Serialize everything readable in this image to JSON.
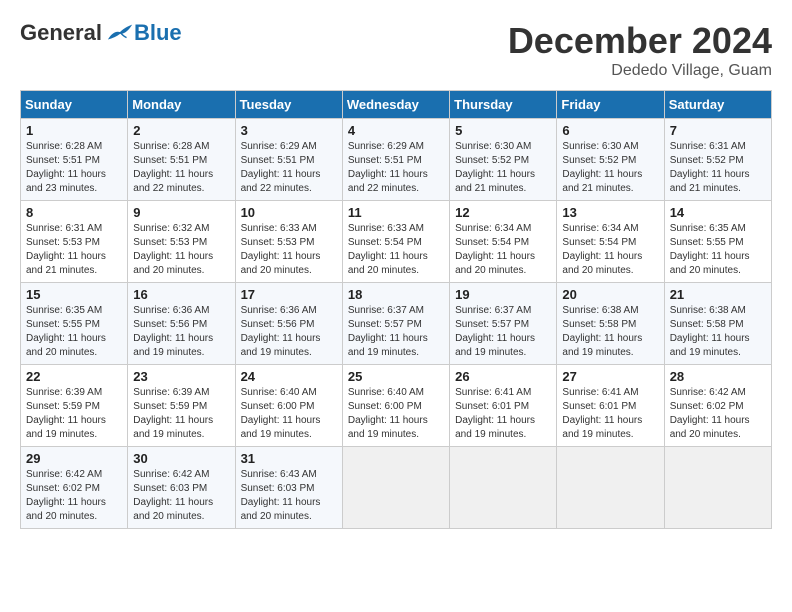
{
  "logo": {
    "general": "General",
    "blue": "Blue"
  },
  "title": "December 2024",
  "subtitle": "Dededo Village, Guam",
  "days_of_week": [
    "Sunday",
    "Monday",
    "Tuesday",
    "Wednesday",
    "Thursday",
    "Friday",
    "Saturday"
  ],
  "weeks": [
    [
      {
        "day": "1",
        "sunrise": "6:28 AM",
        "sunset": "5:51 PM",
        "daylight": "11 hours and 23 minutes."
      },
      {
        "day": "2",
        "sunrise": "6:28 AM",
        "sunset": "5:51 PM",
        "daylight": "11 hours and 22 minutes."
      },
      {
        "day": "3",
        "sunrise": "6:29 AM",
        "sunset": "5:51 PM",
        "daylight": "11 hours and 22 minutes."
      },
      {
        "day": "4",
        "sunrise": "6:29 AM",
        "sunset": "5:51 PM",
        "daylight": "11 hours and 22 minutes."
      },
      {
        "day": "5",
        "sunrise": "6:30 AM",
        "sunset": "5:52 PM",
        "daylight": "11 hours and 21 minutes."
      },
      {
        "day": "6",
        "sunrise": "6:30 AM",
        "sunset": "5:52 PM",
        "daylight": "11 hours and 21 minutes."
      },
      {
        "day": "7",
        "sunrise": "6:31 AM",
        "sunset": "5:52 PM",
        "daylight": "11 hours and 21 minutes."
      }
    ],
    [
      {
        "day": "8",
        "sunrise": "6:31 AM",
        "sunset": "5:53 PM",
        "daylight": "11 hours and 21 minutes."
      },
      {
        "day": "9",
        "sunrise": "6:32 AM",
        "sunset": "5:53 PM",
        "daylight": "11 hours and 20 minutes."
      },
      {
        "day": "10",
        "sunrise": "6:33 AM",
        "sunset": "5:53 PM",
        "daylight": "11 hours and 20 minutes."
      },
      {
        "day": "11",
        "sunrise": "6:33 AM",
        "sunset": "5:54 PM",
        "daylight": "11 hours and 20 minutes."
      },
      {
        "day": "12",
        "sunrise": "6:34 AM",
        "sunset": "5:54 PM",
        "daylight": "11 hours and 20 minutes."
      },
      {
        "day": "13",
        "sunrise": "6:34 AM",
        "sunset": "5:54 PM",
        "daylight": "11 hours and 20 minutes."
      },
      {
        "day": "14",
        "sunrise": "6:35 AM",
        "sunset": "5:55 PM",
        "daylight": "11 hours and 20 minutes."
      }
    ],
    [
      {
        "day": "15",
        "sunrise": "6:35 AM",
        "sunset": "5:55 PM",
        "daylight": "11 hours and 20 minutes."
      },
      {
        "day": "16",
        "sunrise": "6:36 AM",
        "sunset": "5:56 PM",
        "daylight": "11 hours and 19 minutes."
      },
      {
        "day": "17",
        "sunrise": "6:36 AM",
        "sunset": "5:56 PM",
        "daylight": "11 hours and 19 minutes."
      },
      {
        "day": "18",
        "sunrise": "6:37 AM",
        "sunset": "5:57 PM",
        "daylight": "11 hours and 19 minutes."
      },
      {
        "day": "19",
        "sunrise": "6:37 AM",
        "sunset": "5:57 PM",
        "daylight": "11 hours and 19 minutes."
      },
      {
        "day": "20",
        "sunrise": "6:38 AM",
        "sunset": "5:58 PM",
        "daylight": "11 hours and 19 minutes."
      },
      {
        "day": "21",
        "sunrise": "6:38 AM",
        "sunset": "5:58 PM",
        "daylight": "11 hours and 19 minutes."
      }
    ],
    [
      {
        "day": "22",
        "sunrise": "6:39 AM",
        "sunset": "5:59 PM",
        "daylight": "11 hours and 19 minutes."
      },
      {
        "day": "23",
        "sunrise": "6:39 AM",
        "sunset": "5:59 PM",
        "daylight": "11 hours and 19 minutes."
      },
      {
        "day": "24",
        "sunrise": "6:40 AM",
        "sunset": "6:00 PM",
        "daylight": "11 hours and 19 minutes."
      },
      {
        "day": "25",
        "sunrise": "6:40 AM",
        "sunset": "6:00 PM",
        "daylight": "11 hours and 19 minutes."
      },
      {
        "day": "26",
        "sunrise": "6:41 AM",
        "sunset": "6:01 PM",
        "daylight": "11 hours and 19 minutes."
      },
      {
        "day": "27",
        "sunrise": "6:41 AM",
        "sunset": "6:01 PM",
        "daylight": "11 hours and 19 minutes."
      },
      {
        "day": "28",
        "sunrise": "6:42 AM",
        "sunset": "6:02 PM",
        "daylight": "11 hours and 20 minutes."
      }
    ],
    [
      {
        "day": "29",
        "sunrise": "6:42 AM",
        "sunset": "6:02 PM",
        "daylight": "11 hours and 20 minutes."
      },
      {
        "day": "30",
        "sunrise": "6:42 AM",
        "sunset": "6:03 PM",
        "daylight": "11 hours and 20 minutes."
      },
      {
        "day": "31",
        "sunrise": "6:43 AM",
        "sunset": "6:03 PM",
        "daylight": "11 hours and 20 minutes."
      },
      null,
      null,
      null,
      null
    ]
  ],
  "labels": {
    "sunrise": "Sunrise: ",
    "sunset": "Sunset: ",
    "daylight": "Daylight: "
  }
}
